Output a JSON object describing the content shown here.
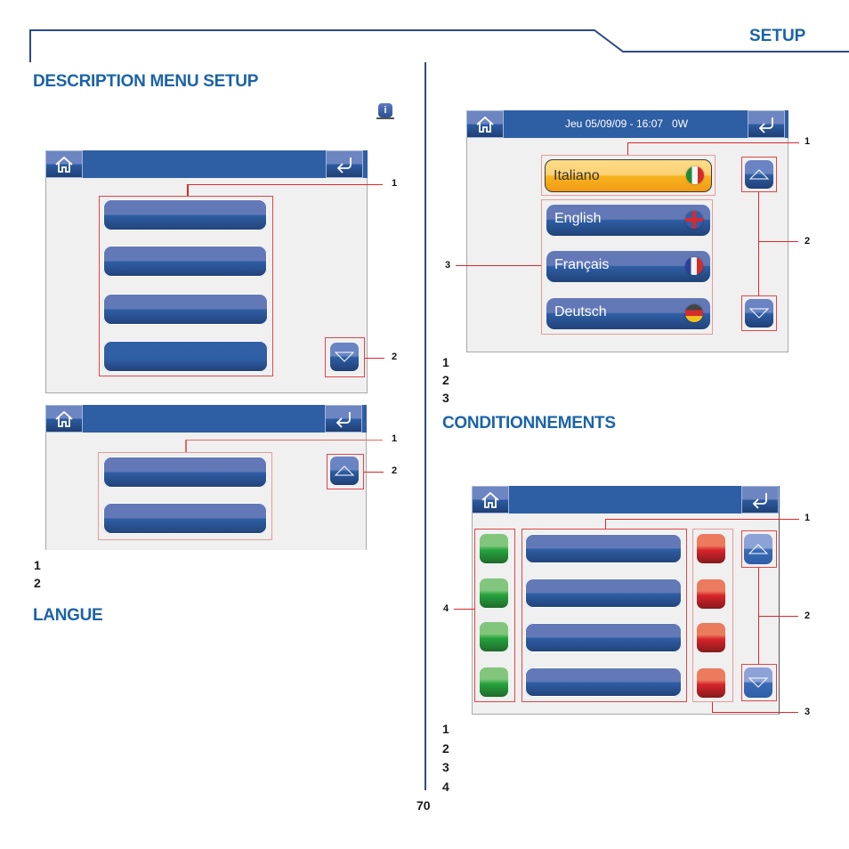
{
  "header": {
    "section_title": "SETUP",
    "page_number": "70"
  },
  "colors": {
    "heading_blue": "#1b63a8",
    "bar_blue": "#2e5ea3",
    "callout_red": "#d9282e",
    "selected_orange": "#f7b41e",
    "green": "#26a43d",
    "red": "#d8242b"
  },
  "sections": {
    "description_menu_setup": {
      "title": "DESCRIPTION MENU SETUP",
      "info_icon": "info-icon",
      "screen1": {
        "callouts": [
          "1",
          "2"
        ],
        "menu_buttons": [
          "",
          "",
          "",
          ""
        ],
        "icons": [
          "home-icon",
          "return-icon",
          "arrow-down-icon"
        ]
      },
      "screen2": {
        "callouts": [
          "1",
          "2"
        ],
        "menu_buttons": [
          "",
          ""
        ],
        "icons": [
          "home-icon",
          "return-icon",
          "arrow-up-icon"
        ]
      },
      "legend": [
        "1",
        "2"
      ]
    },
    "langue": {
      "title": "LANGUE",
      "screen": {
        "status_bar": "Jeu 05/09/09 - 16:07   0W",
        "callouts": [
          "1",
          "2",
          "3"
        ],
        "languages": [
          {
            "label": "Italiano",
            "flag": "italy-flag-icon",
            "selected": true
          },
          {
            "label": "English",
            "flag": "uk-flag-icon",
            "selected": false
          },
          {
            "label": "Français",
            "flag": "france-flag-icon",
            "selected": false
          },
          {
            "label": "Deutsch",
            "flag": "germany-flag-icon",
            "selected": false
          }
        ],
        "icons": [
          "home-icon",
          "return-icon",
          "arrow-up-icon",
          "arrow-down-icon"
        ]
      },
      "legend": [
        "1",
        "2",
        "3"
      ]
    },
    "conditionnements": {
      "title": "CONDITIONNEMENTS",
      "screen": {
        "callouts": [
          "1",
          "2",
          "3",
          "4"
        ],
        "rows": 4,
        "icons": [
          "home-icon",
          "return-icon",
          "arrow-up-icon",
          "arrow-down-icon"
        ]
      },
      "legend": [
        "1",
        "2",
        "3",
        "4"
      ]
    }
  }
}
